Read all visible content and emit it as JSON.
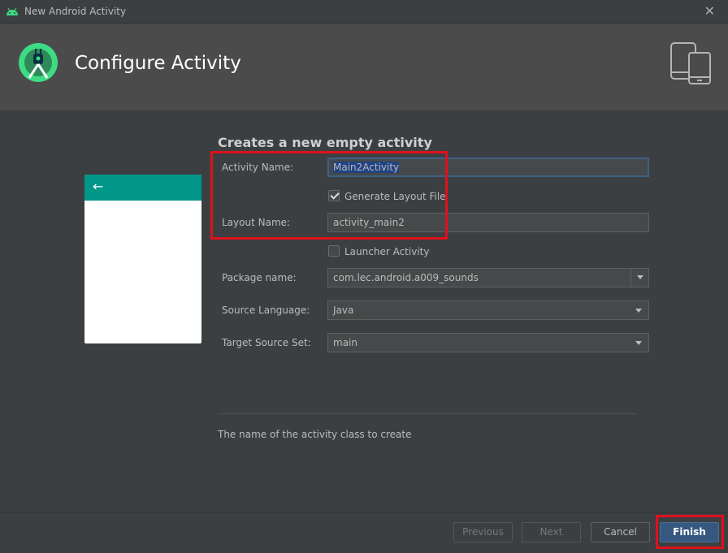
{
  "window": {
    "title": "New Android Activity"
  },
  "header": {
    "heading": "Configure Activity"
  },
  "form": {
    "section_title": "Creates a new empty activity",
    "activity_name_label": "Activity Name:",
    "activity_name_value": "Main2Activity",
    "generate_layout_label": "Generate Layout File",
    "generate_layout_checked": true,
    "layout_name_label": "Layout Name:",
    "layout_name_value": "activity_main2",
    "launcher_label": "Launcher Activity",
    "launcher_checked": false,
    "package_label": "Package name:",
    "package_value": "com.lec.android.a009_sounds",
    "source_language_label": "Source Language:",
    "source_language_value": "Java",
    "target_source_label": "Target Source Set:",
    "target_source_value": "main",
    "hint": "The name of the activity class to create"
  },
  "buttons": {
    "previous": "Previous",
    "next": "Next",
    "cancel": "Cancel",
    "finish": "Finish"
  },
  "colors": {
    "accent": "#009688",
    "highlight": "#e0101c",
    "primary_button": "#365880"
  }
}
